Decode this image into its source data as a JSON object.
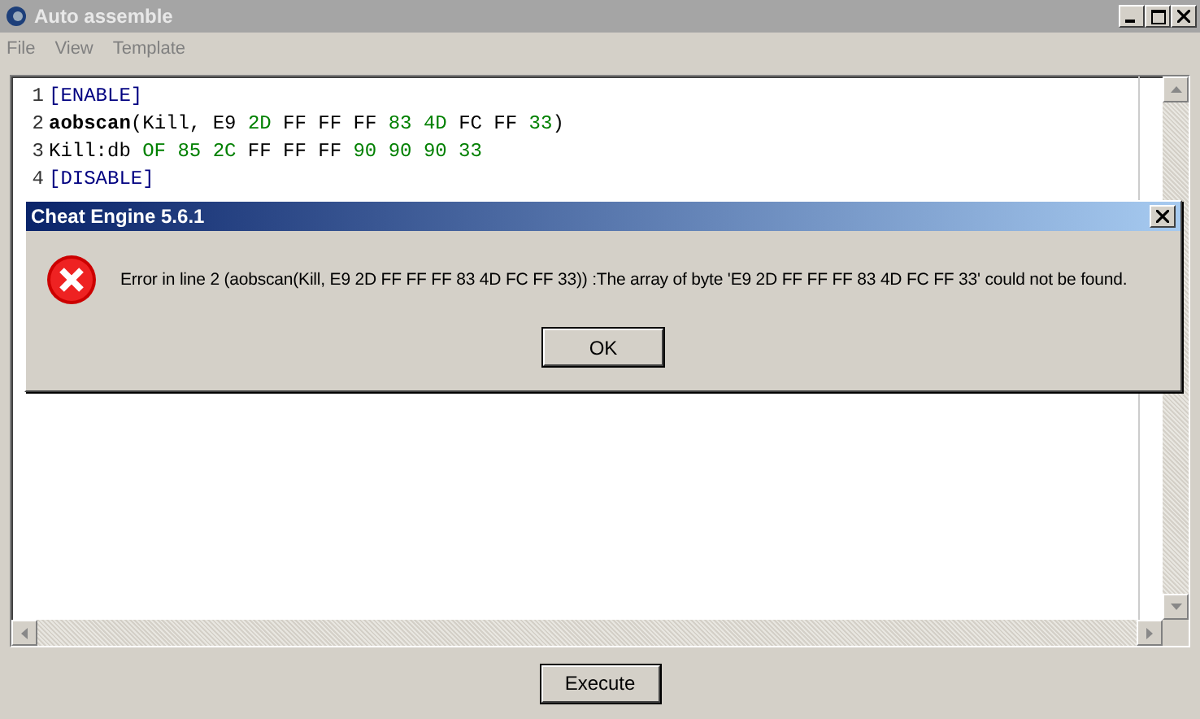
{
  "window": {
    "title": "Auto assemble"
  },
  "menu": [
    "File",
    "View",
    "Template"
  ],
  "editor": {
    "lines": [
      {
        "number": "1",
        "tokens": [
          {
            "text": "[ENABLE]",
            "kind": "directive"
          }
        ]
      },
      {
        "number": "2",
        "tokens": [
          {
            "text": "aobscan",
            "kind": "keyword"
          },
          {
            "text": "(Kill, E9 ",
            "kind": "plain"
          },
          {
            "text": "2D",
            "kind": "number"
          },
          {
            "text": " FF FF FF ",
            "kind": "plain"
          },
          {
            "text": "83 4D",
            "kind": "number"
          },
          {
            "text": " FC FF ",
            "kind": "plain"
          },
          {
            "text": "33",
            "kind": "number"
          },
          {
            "text": ")",
            "kind": "plain"
          }
        ]
      },
      {
        "number": "3",
        "tokens": [
          {
            "text": "Kill:db ",
            "kind": "plain"
          },
          {
            "text": "OF 85 2C",
            "kind": "number"
          },
          {
            "text": " FF FF FF ",
            "kind": "plain"
          },
          {
            "text": "90 90 90 33",
            "kind": "number"
          }
        ]
      },
      {
        "number": "4",
        "tokens": [
          {
            "text": "[DISABLE]",
            "kind": "directive"
          }
        ]
      }
    ]
  },
  "execute_button": "Execute",
  "dialog": {
    "title": "Cheat Engine 5.6.1",
    "message": "Error in line 2 (aobscan(Kill, E9 2D FF FF FF 83 4D FC FF 33)) :The array of byte 'E9 2D FF FF FF 83 4D FC FF 33' could not be found.",
    "button": "OK"
  }
}
